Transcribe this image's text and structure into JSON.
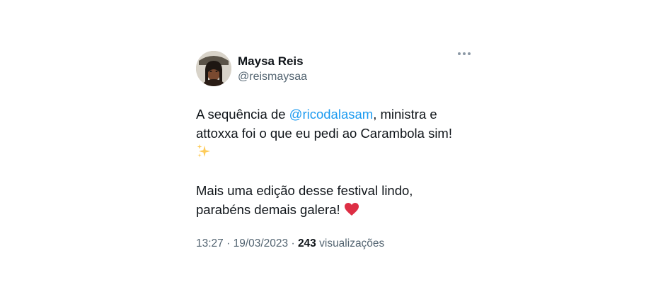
{
  "tweet": {
    "author": {
      "display_name": "Maysa Reis",
      "handle": "@reismaysaa",
      "avatar_icon": "user-avatar"
    },
    "more_icon": "more-options-icon",
    "body": {
      "line1_before": "A sequência de ",
      "mention": "@ricodalasam",
      "line1_after": ", ministra e",
      "line2": "attoxxa foi o que eu pedi ao Carambola sim!",
      "sparkles_icon": "sparkles-emoji",
      "para2_line1": "Mais uma edição desse festival lindo,",
      "para2_line2": "parabéns demais galera! ",
      "heart_icon": "red-heart-emoji"
    },
    "meta": {
      "time": "13:27",
      "separator1": " · ",
      "date": "19/03/2023",
      "separator2": " · ",
      "views_count": "243",
      "views_label": " visualizações"
    },
    "colors": {
      "text": "#0f1419",
      "secondary": "#536471",
      "link": "#1d9bf0",
      "heart": "#e0245e"
    }
  }
}
